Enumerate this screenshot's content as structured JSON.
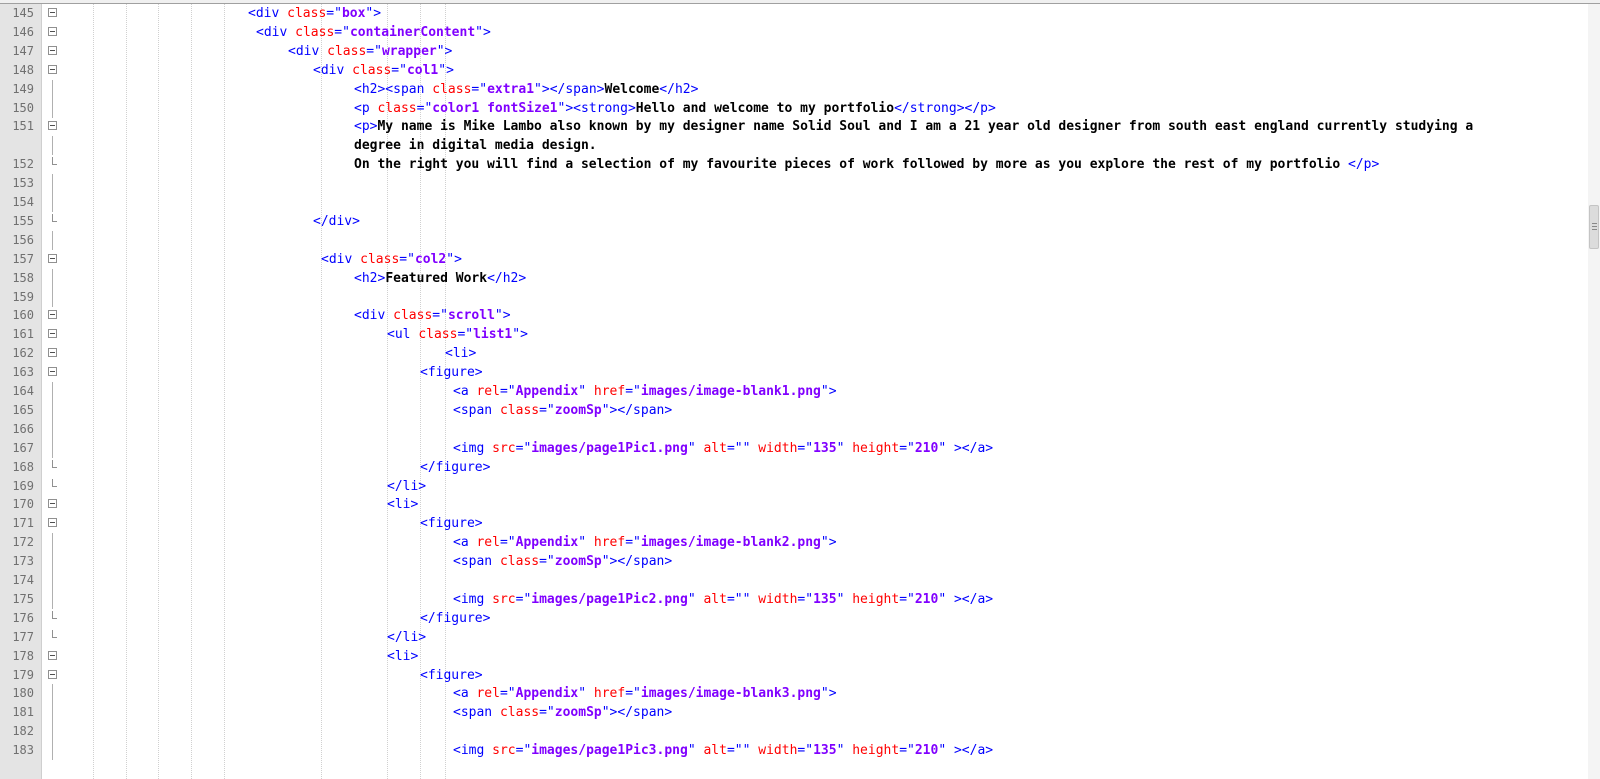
{
  "editor": {
    "lines": [
      {
        "num": "145",
        "indent": 248,
        "fold": "open",
        "tokens": [
          [
            "t",
            "<div "
          ],
          [
            "a",
            "class"
          ],
          [
            "t",
            "=\""
          ],
          [
            "v",
            "box"
          ],
          [
            "t",
            "\">"
          ]
        ]
      },
      {
        "num": "146",
        "indent": 256,
        "fold": "open",
        "tokens": [
          [
            "t",
            "<div "
          ],
          [
            "a",
            "class"
          ],
          [
            "t",
            "=\""
          ],
          [
            "v",
            "containerContent"
          ],
          [
            "t",
            "\">"
          ]
        ]
      },
      {
        "num": "147",
        "indent": 288,
        "fold": "open",
        "tokens": [
          [
            "t",
            "<div "
          ],
          [
            "a",
            "class"
          ],
          [
            "t",
            "=\""
          ],
          [
            "v",
            "wrapper"
          ],
          [
            "t",
            "\">"
          ]
        ]
      },
      {
        "num": "148",
        "indent": 313,
        "fold": "open",
        "tokens": [
          [
            "t",
            "<div "
          ],
          [
            "a",
            "class"
          ],
          [
            "t",
            "=\""
          ],
          [
            "v",
            "col1"
          ],
          [
            "t",
            "\">"
          ]
        ]
      },
      {
        "num": "149",
        "indent": 354,
        "fold": "line",
        "tokens": [
          [
            "t",
            "<h2><span "
          ],
          [
            "a",
            "class"
          ],
          [
            "t",
            "=\""
          ],
          [
            "v",
            "extra1"
          ],
          [
            "t",
            "\"></span>"
          ],
          [
            "x",
            "Welcome"
          ],
          [
            "t",
            "</h2>"
          ]
        ]
      },
      {
        "num": "150",
        "indent": 354,
        "fold": "line",
        "tokens": [
          [
            "t",
            "<p "
          ],
          [
            "a",
            "class"
          ],
          [
            "t",
            "=\""
          ],
          [
            "v",
            "color1 fontSize1"
          ],
          [
            "t",
            "\"><strong>"
          ],
          [
            "x",
            "Hello and welcome to my portfolio"
          ],
          [
            "t",
            "</strong></p>"
          ]
        ]
      },
      {
        "num": "151",
        "indent": 354,
        "fold": "open",
        "tokens": [
          [
            "t",
            "<p>"
          ],
          [
            "x",
            "My name is Mike Lambo also known by my designer name Solid Soul and I am a 21 year old designer from south east england currently studying a"
          ]
        ]
      },
      {
        "num": "",
        "indent": 354,
        "fold": "line",
        "tokens": [
          [
            "x",
            "degree in digital media design."
          ]
        ]
      },
      {
        "num": "152",
        "indent": 354,
        "fold": "end",
        "tokens": [
          [
            "x",
            "On the right you will find a selection of my favourite pieces of work followed by more as you explore the rest of my portfolio "
          ],
          [
            "t",
            "</p>"
          ]
        ]
      },
      {
        "num": "153",
        "indent": 0,
        "fold": "line",
        "tokens": []
      },
      {
        "num": "154",
        "indent": 0,
        "fold": "line",
        "tokens": []
      },
      {
        "num": "155",
        "indent": 313,
        "fold": "end",
        "tokens": [
          [
            "t",
            "</div>"
          ]
        ]
      },
      {
        "num": "156",
        "indent": 0,
        "fold": "line",
        "tokens": []
      },
      {
        "num": "157",
        "indent": 321,
        "fold": "open",
        "tokens": [
          [
            "t",
            "<div "
          ],
          [
            "a",
            "class"
          ],
          [
            "t",
            "=\""
          ],
          [
            "v",
            "col2"
          ],
          [
            "t",
            "\">"
          ]
        ]
      },
      {
        "num": "158",
        "indent": 354,
        "fold": "line",
        "tokens": [
          [
            "t",
            "<h2>"
          ],
          [
            "x",
            "Featured Work"
          ],
          [
            "t",
            "</h2>"
          ]
        ]
      },
      {
        "num": "159",
        "indent": 0,
        "fold": "line",
        "tokens": []
      },
      {
        "num": "160",
        "indent": 354,
        "fold": "open",
        "tokens": [
          [
            "t",
            "<div "
          ],
          [
            "a",
            "class"
          ],
          [
            "t",
            "=\""
          ],
          [
            "v",
            "scroll"
          ],
          [
            "t",
            "\">"
          ]
        ]
      },
      {
        "num": "161",
        "indent": 387,
        "fold": "open",
        "tokens": [
          [
            "t",
            "<ul "
          ],
          [
            "a",
            "class"
          ],
          [
            "t",
            "=\""
          ],
          [
            "v",
            "list1"
          ],
          [
            "t",
            "\">"
          ]
        ]
      },
      {
        "num": "162",
        "indent": 445,
        "fold": "open",
        "tokens": [
          [
            "t",
            "<li>"
          ]
        ]
      },
      {
        "num": "163",
        "indent": 420,
        "fold": "open",
        "tokens": [
          [
            "t",
            "<figure>"
          ]
        ]
      },
      {
        "num": "164",
        "indent": 453,
        "fold": "line",
        "tokens": [
          [
            "t",
            "<a "
          ],
          [
            "a",
            "rel"
          ],
          [
            "t",
            "=\""
          ],
          [
            "v",
            "Appendix"
          ],
          [
            "t",
            "\" "
          ],
          [
            "a",
            "href"
          ],
          [
            "t",
            "=\""
          ],
          [
            "v",
            "images/image-blank1.png"
          ],
          [
            "t",
            "\">"
          ]
        ]
      },
      {
        "num": "165",
        "indent": 453,
        "fold": "line",
        "tokens": [
          [
            "t",
            "<span "
          ],
          [
            "a",
            "class"
          ],
          [
            "t",
            "=\""
          ],
          [
            "v",
            "zoomSp"
          ],
          [
            "t",
            "\"></span>"
          ]
        ]
      },
      {
        "num": "166",
        "indent": 0,
        "fold": "line",
        "tokens": []
      },
      {
        "num": "167",
        "indent": 453,
        "fold": "line",
        "tokens": [
          [
            "t",
            "<img "
          ],
          [
            "a",
            "src"
          ],
          [
            "t",
            "=\""
          ],
          [
            "v",
            "images/page1Pic1.png"
          ],
          [
            "t",
            "\" "
          ],
          [
            "a",
            "alt"
          ],
          [
            "t",
            "=\"\" "
          ],
          [
            "a",
            "width"
          ],
          [
            "t",
            "=\""
          ],
          [
            "v",
            "135"
          ],
          [
            "t",
            "\" "
          ],
          [
            "a",
            "height"
          ],
          [
            "t",
            "=\""
          ],
          [
            "v",
            "210"
          ],
          [
            "t",
            "\" ></a>"
          ]
        ]
      },
      {
        "num": "168",
        "indent": 420,
        "fold": "end",
        "tokens": [
          [
            "t",
            "</figure>"
          ]
        ]
      },
      {
        "num": "169",
        "indent": 387,
        "fold": "end",
        "tokens": [
          [
            "t",
            "</li>"
          ]
        ]
      },
      {
        "num": "170",
        "indent": 387,
        "fold": "open",
        "tokens": [
          [
            "t",
            "<li>"
          ]
        ]
      },
      {
        "num": "171",
        "indent": 420,
        "fold": "open",
        "tokens": [
          [
            "t",
            "<figure>"
          ]
        ]
      },
      {
        "num": "172",
        "indent": 453,
        "fold": "line",
        "tokens": [
          [
            "t",
            "<a "
          ],
          [
            "a",
            "rel"
          ],
          [
            "t",
            "=\""
          ],
          [
            "v",
            "Appendix"
          ],
          [
            "t",
            "\" "
          ],
          [
            "a",
            "href"
          ],
          [
            "t",
            "=\""
          ],
          [
            "v",
            "images/image-blank2.png"
          ],
          [
            "t",
            "\">"
          ]
        ]
      },
      {
        "num": "173",
        "indent": 453,
        "fold": "line",
        "tokens": [
          [
            "t",
            "<span "
          ],
          [
            "a",
            "class"
          ],
          [
            "t",
            "=\""
          ],
          [
            "v",
            "zoomSp"
          ],
          [
            "t",
            "\"></span>"
          ]
        ]
      },
      {
        "num": "174",
        "indent": 0,
        "fold": "line",
        "tokens": []
      },
      {
        "num": "175",
        "indent": 453,
        "fold": "line",
        "tokens": [
          [
            "t",
            "<img "
          ],
          [
            "a",
            "src"
          ],
          [
            "t",
            "=\""
          ],
          [
            "v",
            "images/page1Pic2.png"
          ],
          [
            "t",
            "\" "
          ],
          [
            "a",
            "alt"
          ],
          [
            "t",
            "=\"\" "
          ],
          [
            "a",
            "width"
          ],
          [
            "t",
            "=\""
          ],
          [
            "v",
            "135"
          ],
          [
            "t",
            "\" "
          ],
          [
            "a",
            "height"
          ],
          [
            "t",
            "=\""
          ],
          [
            "v",
            "210"
          ],
          [
            "t",
            "\" ></a>"
          ]
        ]
      },
      {
        "num": "176",
        "indent": 420,
        "fold": "end",
        "tokens": [
          [
            "t",
            "</figure>"
          ]
        ]
      },
      {
        "num": "177",
        "indent": 387,
        "fold": "end",
        "tokens": [
          [
            "t",
            "</li>"
          ]
        ]
      },
      {
        "num": "178",
        "indent": 387,
        "fold": "open",
        "tokens": [
          [
            "t",
            "<li>"
          ]
        ]
      },
      {
        "num": "179",
        "indent": 420,
        "fold": "open",
        "tokens": [
          [
            "t",
            "<figure>"
          ]
        ]
      },
      {
        "num": "180",
        "indent": 453,
        "fold": "line",
        "tokens": [
          [
            "t",
            "<a "
          ],
          [
            "a",
            "rel"
          ],
          [
            "t",
            "=\""
          ],
          [
            "v",
            "Appendix"
          ],
          [
            "t",
            "\" "
          ],
          [
            "a",
            "href"
          ],
          [
            "t",
            "=\""
          ],
          [
            "v",
            "images/image-blank3.png"
          ],
          [
            "t",
            "\">"
          ]
        ]
      },
      {
        "num": "181",
        "indent": 453,
        "fold": "line",
        "tokens": [
          [
            "t",
            "<span "
          ],
          [
            "a",
            "class"
          ],
          [
            "t",
            "=\""
          ],
          [
            "v",
            "zoomSp"
          ],
          [
            "t",
            "\"></span>"
          ]
        ]
      },
      {
        "num": "182",
        "indent": 0,
        "fold": "line",
        "tokens": []
      },
      {
        "num": "183",
        "indent": 453,
        "fold": "line",
        "tokens": [
          [
            "t",
            "<img "
          ],
          [
            "a",
            "src"
          ],
          [
            "t",
            "=\""
          ],
          [
            "v",
            "images/page1Pic3.png"
          ],
          [
            "t",
            "\" "
          ],
          [
            "a",
            "alt"
          ],
          [
            "t",
            "=\"\" "
          ],
          [
            "a",
            "width"
          ],
          [
            "t",
            "=\""
          ],
          [
            "v",
            "135"
          ],
          [
            "t",
            "\" "
          ],
          [
            "a",
            "height"
          ],
          [
            "t",
            "=\""
          ],
          [
            "v",
            "210"
          ],
          [
            "t",
            "\" ></a>"
          ]
        ]
      }
    ]
  },
  "colors": {
    "tag": "#0000ff",
    "attribute": "#ff0000",
    "value": "#8000ff",
    "text": "#000000",
    "gutter": "#e4e4e4",
    "line_number": "#707070"
  }
}
